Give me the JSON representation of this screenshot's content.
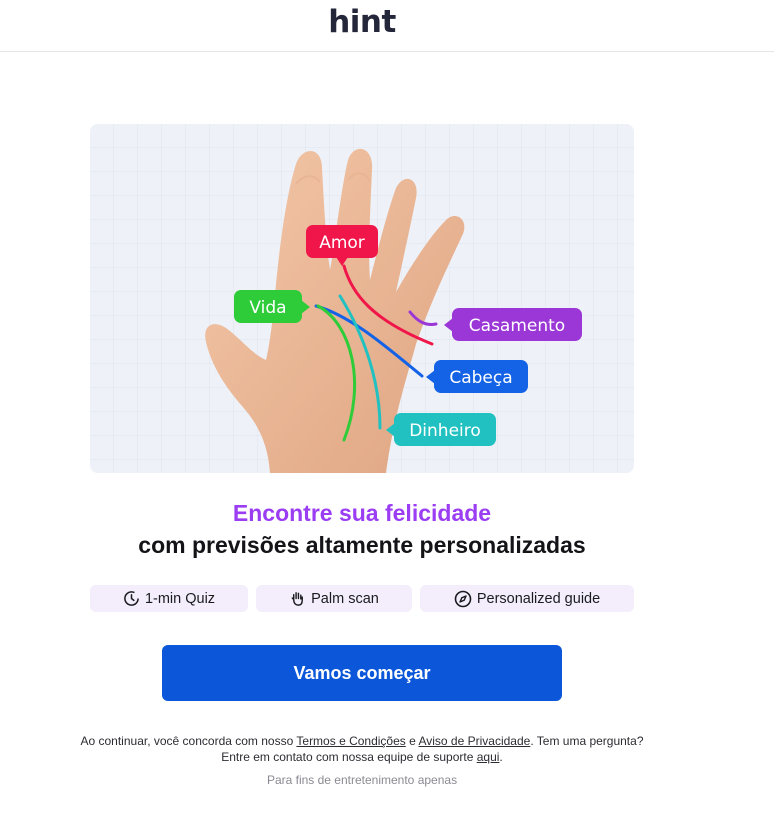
{
  "header": {
    "logo": "hint"
  },
  "hero": {
    "labels": {
      "amor": "Amor",
      "vida": "Vida",
      "casamento": "Casamento",
      "cabeca": "Cabeça",
      "dinheiro": "Dinheiro"
    },
    "colors": {
      "amor": "#f0164a",
      "vida": "#2fcc3a",
      "casamento": "#9a37d6",
      "cabeca": "#1463e6",
      "dinheiro": "#22c1c1"
    }
  },
  "headline": {
    "accent": "Encontre sua felicidade",
    "main": "com previsões altamente personalizadas"
  },
  "features": [
    {
      "label": "1-min Quiz",
      "icon": "timer-icon"
    },
    {
      "label": "Palm scan",
      "icon": "hand-icon"
    },
    {
      "label": "Personalized guide",
      "icon": "compass-icon"
    }
  ],
  "cta": {
    "label": "Vamos começar"
  },
  "legal": {
    "prefix": "Ao continuar, você concorda com nosso ",
    "terms_link": "Termos e Condições",
    "and": " e ",
    "privacy_link": "Aviso de Privacidade",
    "middle": ". Tem uma pergunta? Entre em contato com nossa equipe de suporte ",
    "support_link": "aqui",
    "suffix": "."
  },
  "disclaimer": "Para fins de entretenimento apenas",
  "theme": {
    "accent": "#9b3df2",
    "primary": "#0b56d9",
    "chip_bg": "#f4eefc"
  }
}
